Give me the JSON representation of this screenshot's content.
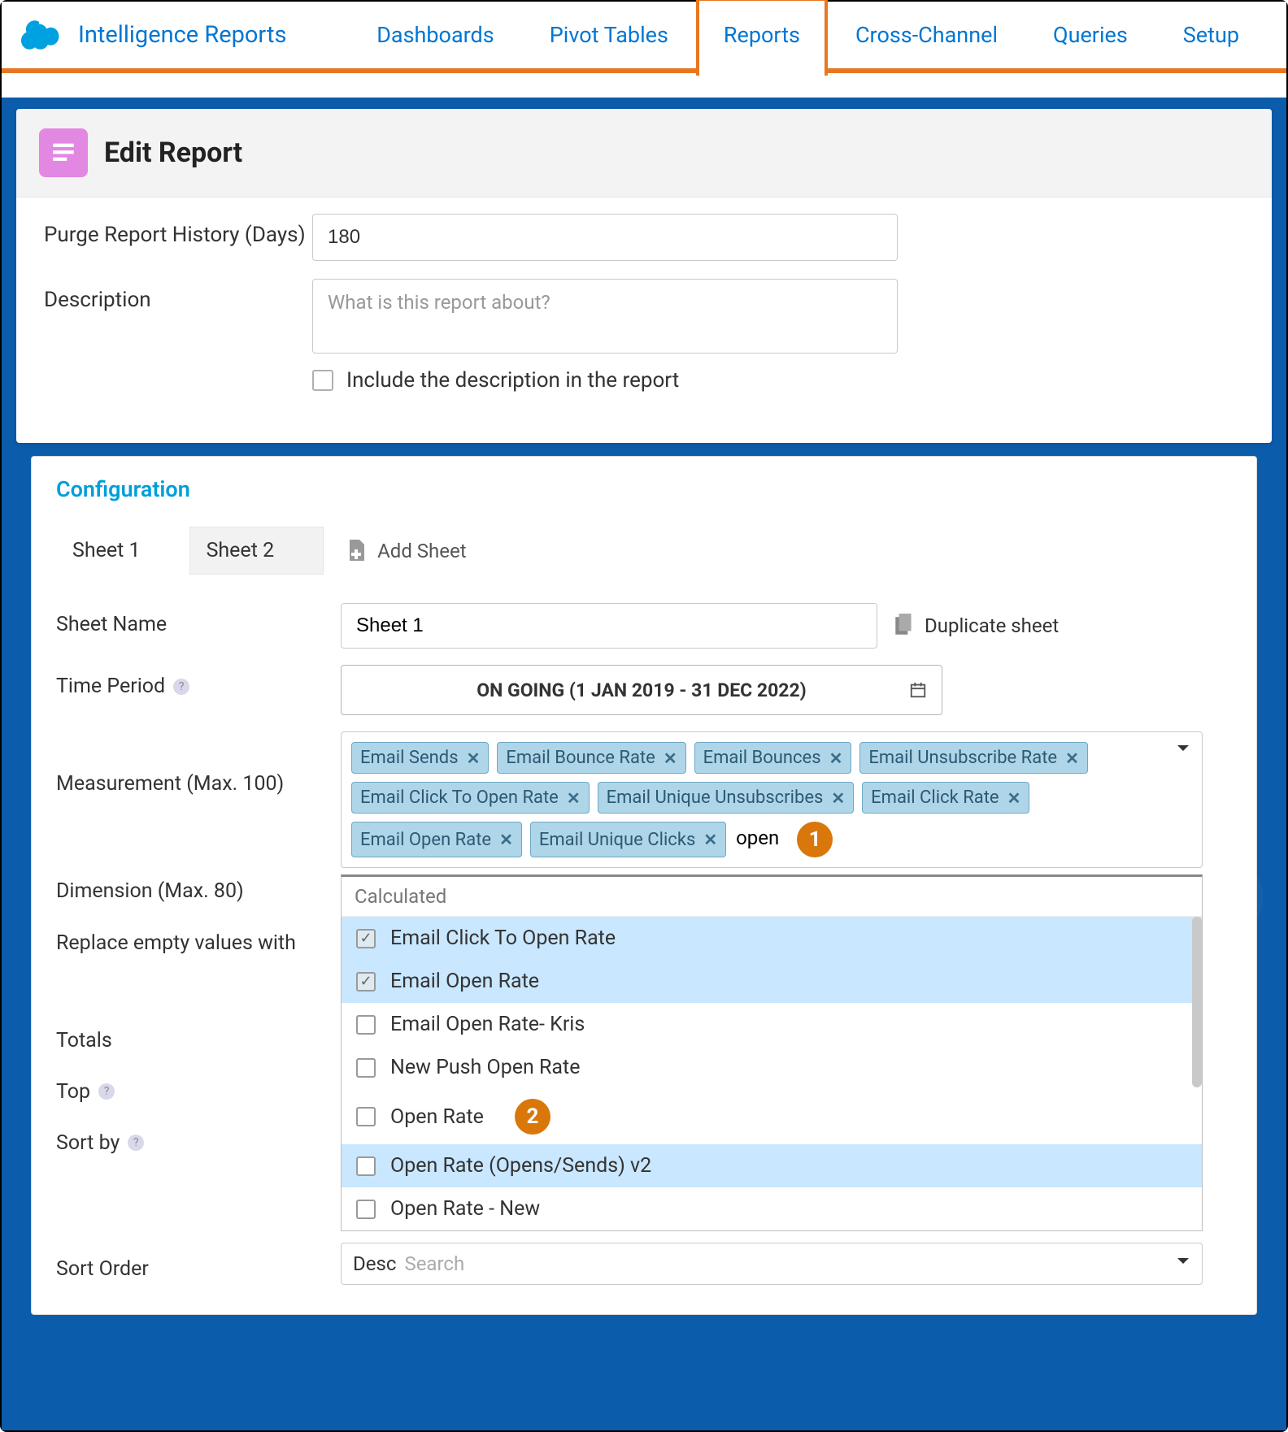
{
  "brand": "Intelligence Reports",
  "nav": {
    "items": [
      "Dashboards",
      "Pivot Tables",
      "Reports",
      "Cross-Channel",
      "Queries",
      "Setup"
    ],
    "active_index": 2
  },
  "page_title": "Edit Report",
  "form": {
    "purge_label": "Purge Report History (Days)",
    "purge_value": "180",
    "description_label": "Description",
    "description_placeholder": "What is this report about?",
    "include_desc_label": "Include the description in the report"
  },
  "config": {
    "title": "Configuration",
    "sheets": [
      "Sheet 1",
      "Sheet 2"
    ],
    "active_sheet_index": 0,
    "add_sheet_label": "Add Sheet",
    "sheet_name_label": "Sheet Name",
    "sheet_name_value": "Sheet 1",
    "duplicate_label": "Duplicate sheet",
    "time_period_label": "Time Period",
    "time_period_value": "ON GOING (1 JAN 2019 - 31 DEC 2022)",
    "measurement_label": "Measurement (Max. 100)",
    "dimension_label": "Dimension (Max. 80)",
    "replace_empty_label": "Replace empty values with",
    "totals_label": "Totals",
    "top_label": "Top",
    "sortby_label": "Sort by",
    "sortorder_label": "Sort Order",
    "sortorder_value": "Desc",
    "sortorder_placeholder": "Search",
    "chips": [
      "Email Sends",
      "Email Bounce Rate",
      "Email Bounces",
      "Email Unsubscribe Rate",
      "Email Click To Open Rate",
      "Email Unique Unsubscribes",
      "Email Click Rate",
      "Email Open Rate",
      "Email Unique Clicks"
    ],
    "search_text": "open",
    "dropdown_header": "Calculated",
    "dropdown_items": [
      {
        "label": "Email Click To Open Rate",
        "checked": true,
        "selected": true
      },
      {
        "label": "Email Open Rate",
        "checked": true,
        "selected": true
      },
      {
        "label": "Email Open Rate- Kris",
        "checked": false,
        "selected": false
      },
      {
        "label": "New Push Open Rate",
        "checked": false,
        "selected": false
      },
      {
        "label": "Open Rate",
        "checked": false,
        "selected": false
      },
      {
        "label": "Open Rate (Opens/Sends) v2",
        "checked": false,
        "selected": false,
        "hover": true
      },
      {
        "label": "Open Rate - New",
        "checked": false,
        "selected": false
      }
    ]
  },
  "callouts": {
    "one": "1",
    "two": "2"
  }
}
